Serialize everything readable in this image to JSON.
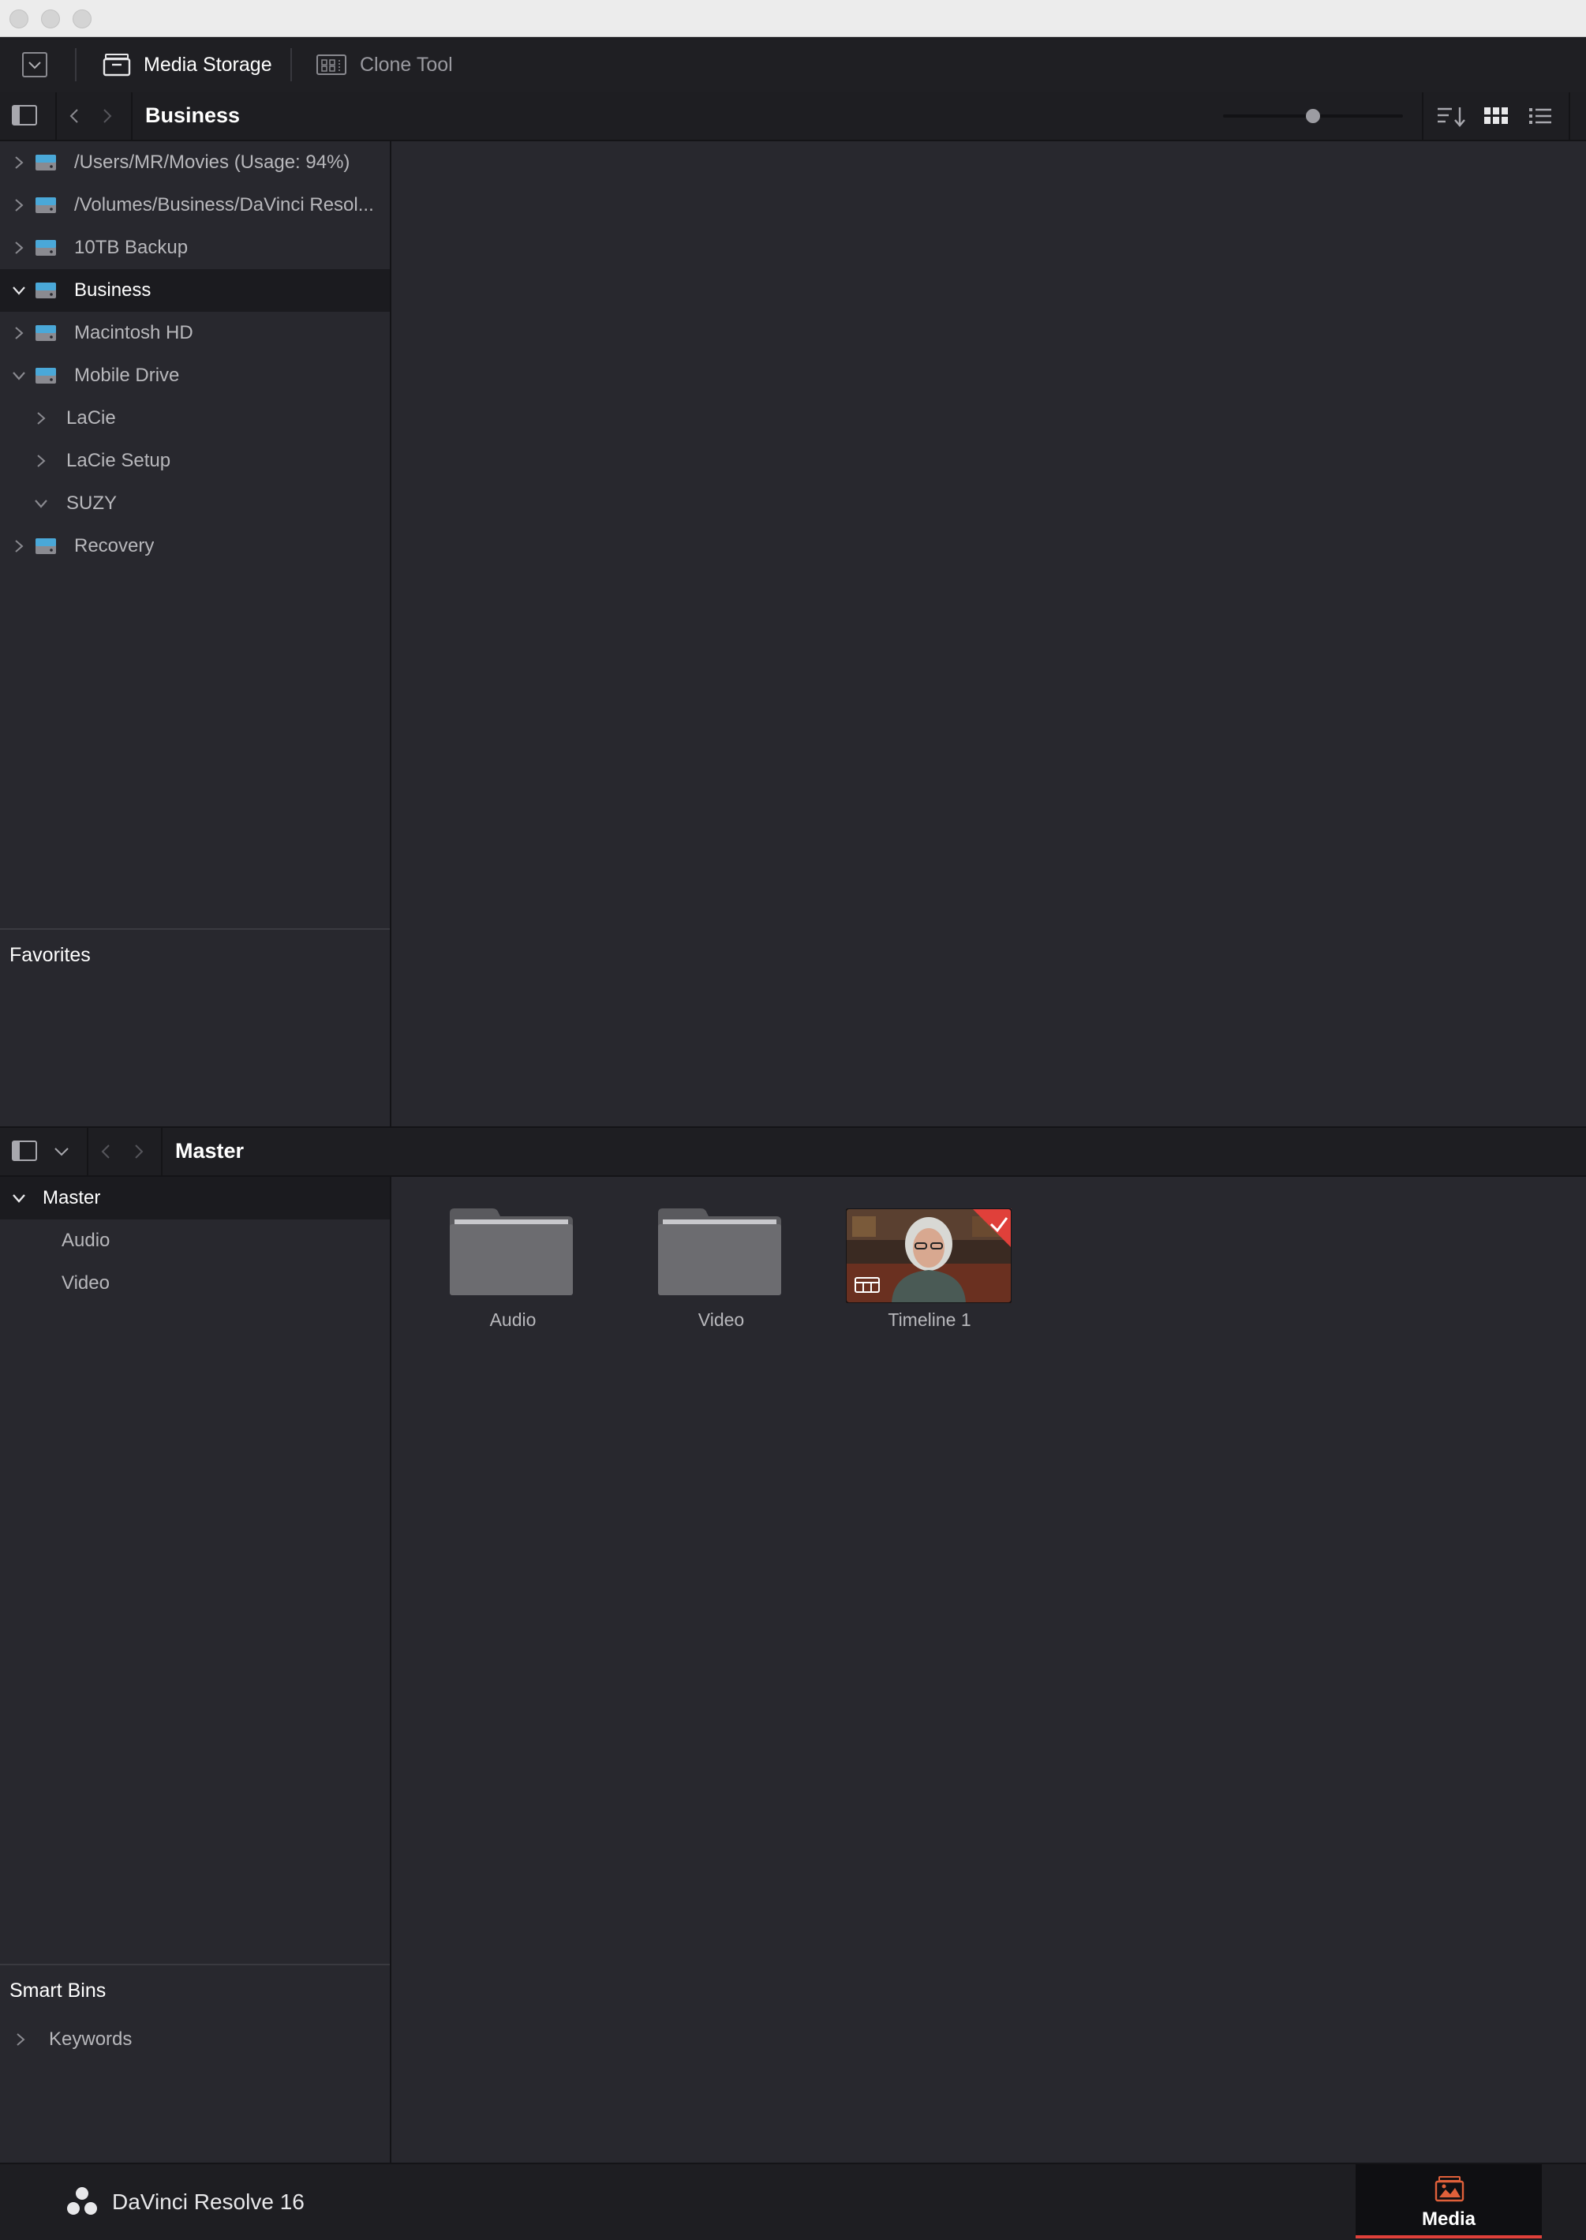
{
  "toolbar": {
    "tabs": [
      {
        "label": "Media Storage",
        "active": true
      },
      {
        "label": "Clone Tool",
        "active": false
      }
    ]
  },
  "storage_nav": {
    "title": "Business"
  },
  "storage_tree": [
    {
      "label": "/Users/MR/Movies (Usage: 94%)",
      "expanded": false
    },
    {
      "label": "/Volumes/Business/DaVinci Resol...",
      "expanded": false
    },
    {
      "label": "10TB Backup",
      "expanded": false
    },
    {
      "label": "Business",
      "expanded": true,
      "selected": true
    },
    {
      "label": "Macintosh HD",
      "expanded": false
    },
    {
      "label": "Mobile Drive",
      "expanded": true
    },
    {
      "label": "LaCie",
      "expanded": false,
      "child": true
    },
    {
      "label": "LaCie Setup",
      "expanded": false,
      "child": true
    },
    {
      "label": "SUZY",
      "expanded": true,
      "child": true
    },
    {
      "label": "Recovery",
      "expanded": false
    }
  ],
  "favorites": {
    "label": "Favorites"
  },
  "bin_nav": {
    "title": "Master"
  },
  "bin_tree": {
    "root": "Master",
    "children": [
      "Audio",
      "Video"
    ]
  },
  "smart_bins": {
    "label": "Smart Bins",
    "items": [
      "Keywords"
    ]
  },
  "media_items": [
    {
      "type": "folder",
      "label": "Audio"
    },
    {
      "type": "folder",
      "label": "Video"
    },
    {
      "type": "timeline",
      "label": "Timeline 1"
    }
  ],
  "footer": {
    "app_name": "DaVinci Resolve 16",
    "page_tab": "Media"
  },
  "colors": {
    "accent_red": "#e0403a",
    "drive_blue": "#4aa8d8"
  }
}
